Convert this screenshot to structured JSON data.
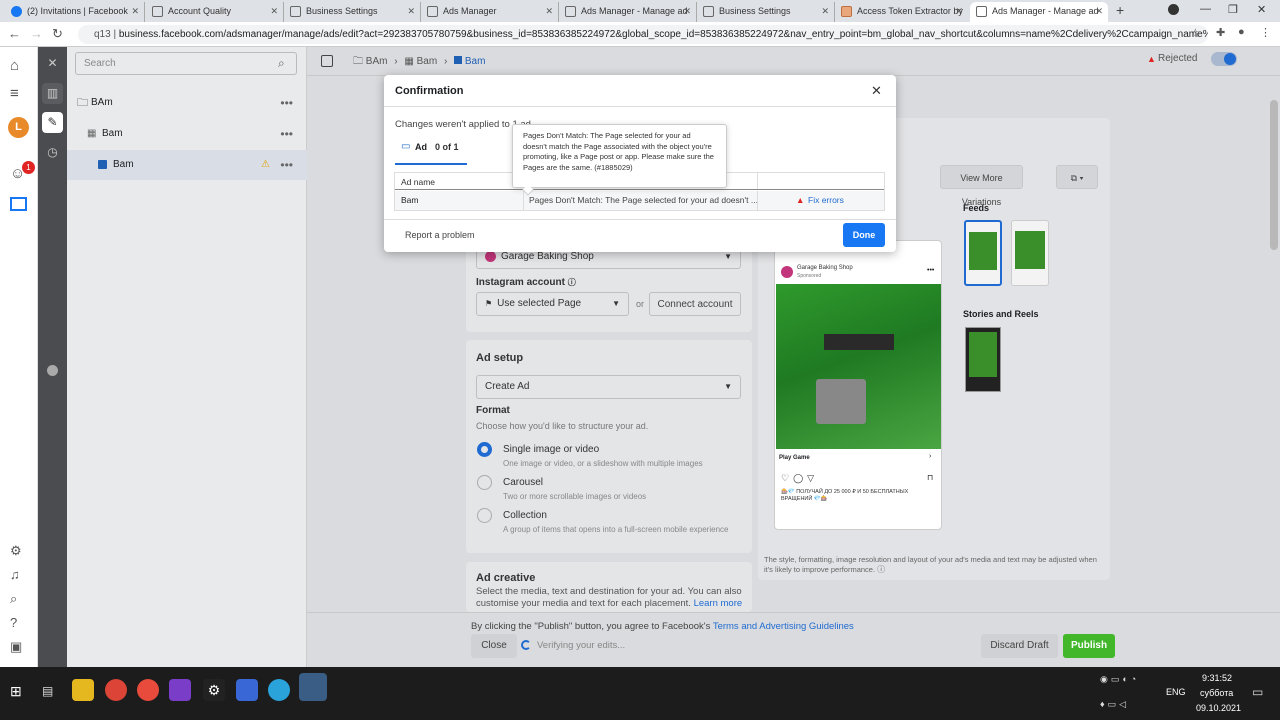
{
  "browser": {
    "tabs": [
      {
        "title": "(2) Invitations | Facebook",
        "active": false
      },
      {
        "title": "Account Quality",
        "active": false
      },
      {
        "title": "Business Settings",
        "active": false
      },
      {
        "title": "Ads Manager",
        "active": false
      },
      {
        "title": "Ads Manager - Manage ad",
        "active": false
      },
      {
        "title": "Business Settings",
        "active": false
      },
      {
        "title": "Access Token Extractor by",
        "active": false
      },
      {
        "title": "Ads Manager - Manage ad",
        "active": true
      }
    ],
    "url_prefix": "q13",
    "url": "business.facebook.com/adsmanager/manage/ads/edit?act=292383705780759&business_id=853836385224972&global_scope_id=853836385224972&nav_entry_point=bm_global_nav_shortcut&columns=name%2Cdelivery%2Ccampaign_name%2Cbid%2Cb..."
  },
  "sidebar": {
    "search_placeholder": "Search",
    "tree": [
      {
        "label": "BAm",
        "level": 0
      },
      {
        "label": "Bam",
        "level": 1
      },
      {
        "label": "Bam",
        "level": 2
      }
    ],
    "notification_count": "1",
    "avatar_letter": "L"
  },
  "breadcrumb": [
    "BAm",
    "Bam",
    "Bam"
  ],
  "status": {
    "label": "Rejected"
  },
  "form": {
    "page_value": "Garage Baking Shop",
    "instagram_label": "Instagram account",
    "instagram_value": "Use selected Page",
    "or_text": "or",
    "connect_button": "Connect account",
    "ad_setup_title": "Ad setup",
    "create_select": "Create Ad",
    "format_label": "Format",
    "format_hint": "Choose how you'd like to structure your ad.",
    "formats": [
      {
        "title": "Single image or video",
        "desc": "One image or video, or a slideshow with multiple images",
        "selected": true
      },
      {
        "title": "Carousel",
        "desc": "Two or more scrollable images or videos",
        "selected": false
      },
      {
        "title": "Collection",
        "desc": "A group of items that opens into a full-screen mobile experience",
        "selected": false
      }
    ],
    "creative_title": "Ad creative",
    "creative_desc": "Select the media, text and destination for your ad. You can also customise your media and text for each placement.",
    "learn_more": "Learn more"
  },
  "preview": {
    "view_more": "View More Variations",
    "feeds_label": "Feeds",
    "stories_label": "Stories and Reels",
    "page_name": "Garage Baking Shop",
    "sponsored": "Sponsored",
    "cta": "Play Game",
    "caption": "🎰💎 ПОЛУЧАЙ ДО 25 000 ₽ И 50 БЕСПЛАТНЫХ ВРАЩЕНИЙ 💎🎰",
    "disclaimer": "The style, formatting, image resolution and layout of your ad's media and text may be adjusted when it's likely to improve performance."
  },
  "footer": {
    "terms_prefix": "By clicking the \"Publish\" button, you agree to Facebook's",
    "terms_link": "Terms and Advertising Guidelines",
    "close_button": "Close",
    "verifying": "Verifying your edits...",
    "discard_button": "Discard Draft",
    "publish_button": "Publish"
  },
  "dialog": {
    "title": "Confirmation",
    "subtitle": "Changes weren't applied to 1 ad",
    "tab_label": "Ad",
    "tab_count": "0 of 1",
    "column_header": "Ad name",
    "row_name": "Bam",
    "row_error": "Pages Don't Match: The Page selected for your ad doesn't ...",
    "fix_link": "Fix errors",
    "report_link": "Report a problem",
    "done_button": "Done",
    "tooltip": "Pages Don't Match: The Page selected for your ad doesn't match the Page associated with the object you're promoting, like a Page post or app. Please make sure the Pages are the same. (#1885029)"
  },
  "taskbar": {
    "lang": "ENG",
    "time": "9:31:52",
    "day": "суббота",
    "date": "09.10.2021"
  },
  "colors": {
    "accent": "#1877f2",
    "publish": "#42b72a",
    "error": "#e02424"
  }
}
